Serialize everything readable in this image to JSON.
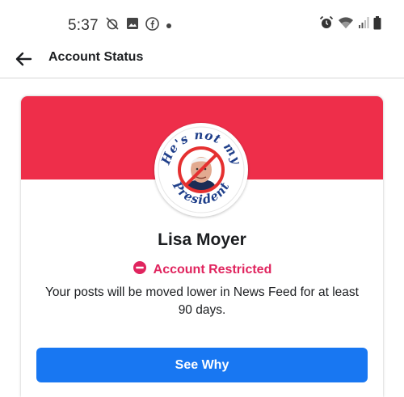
{
  "status_bar": {
    "time": "5:37",
    "left_icons": [
      "alarm-off-icon",
      "gallery-icon",
      "facebook-icon",
      "dot-icon"
    ],
    "right_icons": [
      "alarm-icon",
      "wifi-icon",
      "signal-icon",
      "battery-icon"
    ]
  },
  "header": {
    "back_icon": "arrow-left-icon",
    "title": "Account Status"
  },
  "card": {
    "banner_color": "#ee2e4a",
    "avatar": {
      "top_text": "He's not my",
      "bottom_text": "President"
    },
    "user_name": "Lisa Moyer",
    "status_icon": "restricted-icon",
    "status_label": "Account Restricted",
    "status_color": "#e0245e",
    "description": "Your posts will be moved lower in News Feed for at least 90 days.",
    "button_label": "See Why",
    "button_color": "#1877f2"
  }
}
